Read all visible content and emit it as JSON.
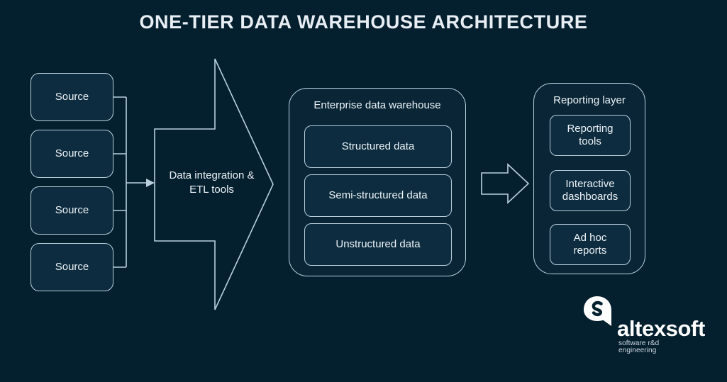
{
  "page": {
    "title": "ONE-TIER DATA WAREHOUSE ARCHITECTURE",
    "background_color": "#04202f",
    "stroke_color": "#b9cfdd",
    "box_fill_color": "#0d2c3f",
    "text_color": "#edf3f7"
  },
  "sources": {
    "items": [
      {
        "label": "Source"
      },
      {
        "label": "Source"
      },
      {
        "label": "Source"
      },
      {
        "label": "Source"
      }
    ]
  },
  "etl": {
    "label_line1": "Data integration &",
    "label_line2": "ETL tools",
    "shape": "chevron-arrow"
  },
  "warehouse": {
    "title": "Enterprise data warehouse",
    "boxes": [
      {
        "label": "Structured data"
      },
      {
        "label": "Semi-structured data"
      },
      {
        "label": "Unstructured data"
      }
    ]
  },
  "flow_arrow": {
    "name": "warehouse-to-reporting-arrow",
    "direction": "right"
  },
  "reporting": {
    "title": "Reporting layer",
    "boxes": [
      {
        "line1": "Reporting",
        "line2": "tools"
      },
      {
        "line1": "Interactive",
        "line2": "dashboards"
      },
      {
        "line1": "Ad hoc",
        "line2": "reports"
      }
    ]
  },
  "logo": {
    "wordmark": "altexsoft",
    "tagline": "software r&d engineering",
    "mark_color": "#ffffff"
  }
}
